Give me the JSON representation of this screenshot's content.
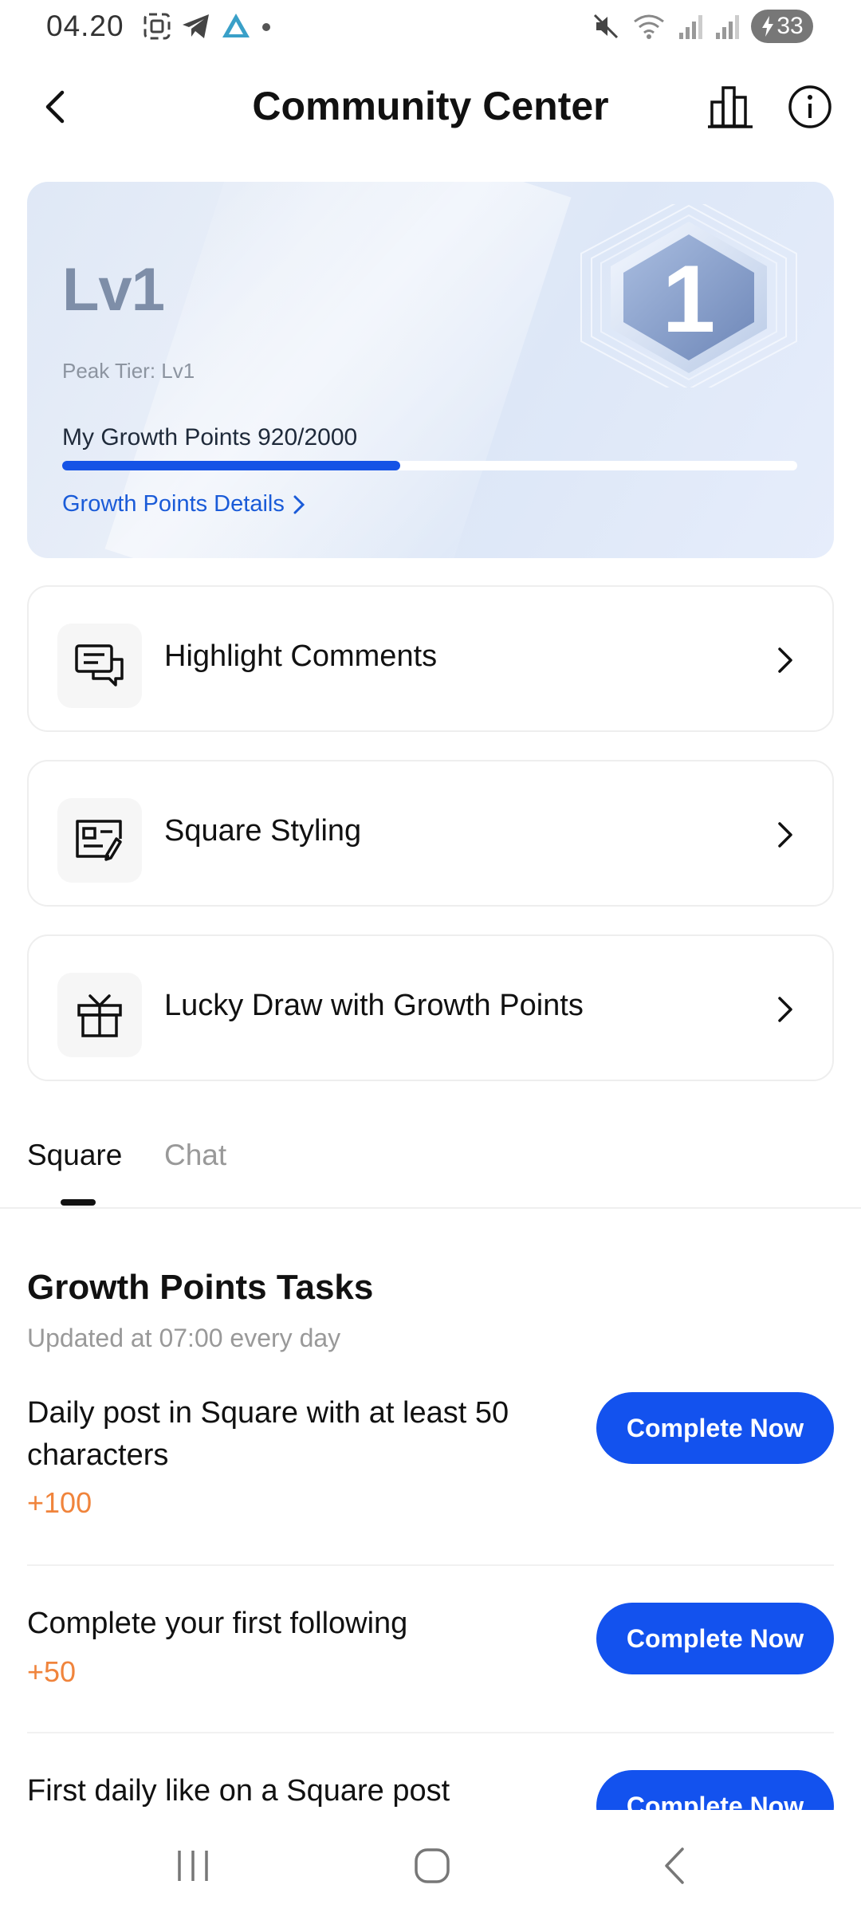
{
  "status_bar": {
    "time": "04.20",
    "battery": "33"
  },
  "header": {
    "title": "Community Center"
  },
  "level_card": {
    "level": "Lv1",
    "peak_tier": "Peak Tier: Lv1",
    "growth_points_label": "My Growth Points 920/2000",
    "progress_fraction": 0.46,
    "details_link": "Growth Points Details",
    "badge_number": "1"
  },
  "menu": [
    {
      "label": "Highlight Comments",
      "icon": "comments-icon"
    },
    {
      "label": "Square Styling",
      "icon": "profile-card-edit-icon"
    },
    {
      "label": "Lucky Draw with Growth Points",
      "icon": "gift-icon"
    }
  ],
  "tabs": [
    {
      "label": "Square",
      "active": true
    },
    {
      "label": "Chat",
      "active": false
    }
  ],
  "tasks": {
    "title": "Growth Points Tasks",
    "subtitle": "Updated at 07:00 every day",
    "items": [
      {
        "description": "Daily post in Square with at least 50 characters",
        "points": "+100",
        "button": "Complete Now"
      },
      {
        "description": "Complete your first following",
        "points": "+50",
        "button": "Complete Now"
      },
      {
        "description": "First daily like on a Square post",
        "points": "",
        "button": "Complete Now"
      }
    ]
  },
  "colors": {
    "accent_blue": "#1352ee",
    "points_orange": "#f0843c",
    "level_text": "#7e8ea8"
  }
}
